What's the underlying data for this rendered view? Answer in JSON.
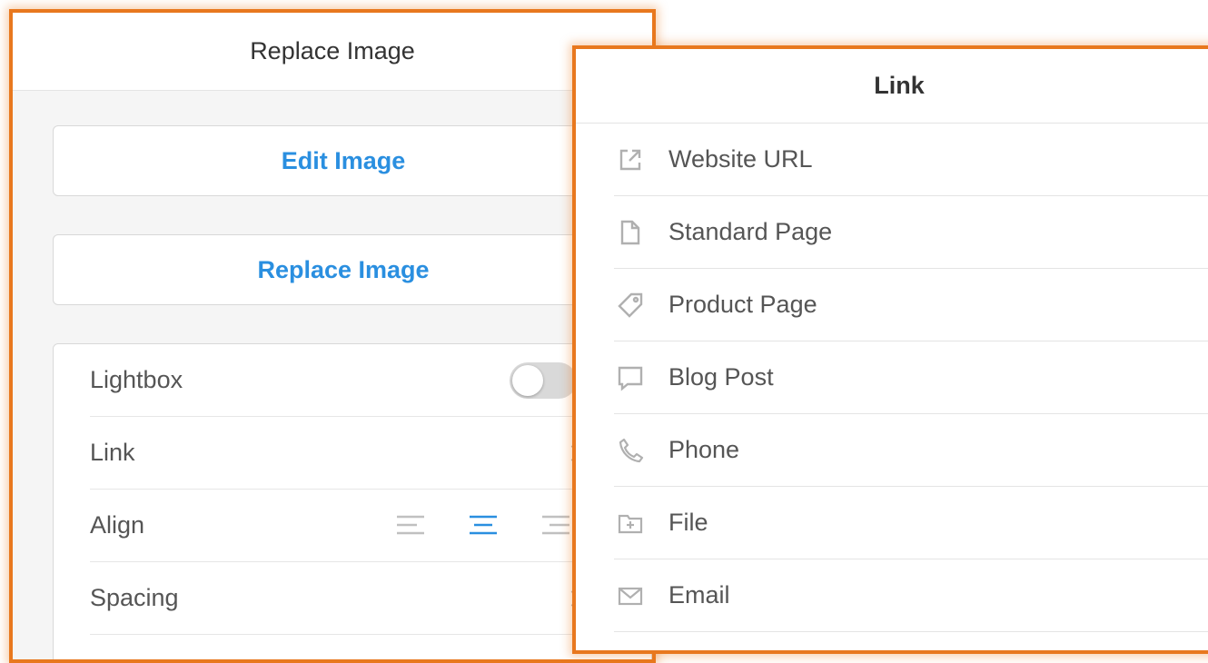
{
  "replace_panel": {
    "title": "Replace Image",
    "edit_button": "Edit Image",
    "replace_button": "Replace Image",
    "settings": {
      "lightbox_label": "Lightbox",
      "lightbox_enabled": false,
      "link_label": "Link",
      "align_label": "Align",
      "align_selected": "center",
      "spacing_label": "Spacing"
    }
  },
  "link_panel": {
    "title": "Link",
    "items": [
      {
        "label": "Website URL",
        "icon": "external-link-icon"
      },
      {
        "label": "Standard Page",
        "icon": "page-icon"
      },
      {
        "label": "Product Page",
        "icon": "tag-icon"
      },
      {
        "label": "Blog Post",
        "icon": "speech-bubble-icon"
      },
      {
        "label": "Phone",
        "icon": "phone-icon"
      },
      {
        "label": "File",
        "icon": "folder-icon"
      },
      {
        "label": "Email",
        "icon": "envelope-icon"
      }
    ]
  },
  "colors": {
    "accent_blue": "#2a8fe0",
    "highlight_orange": "#e8781e",
    "icon_gray": "#b0b0b0"
  }
}
